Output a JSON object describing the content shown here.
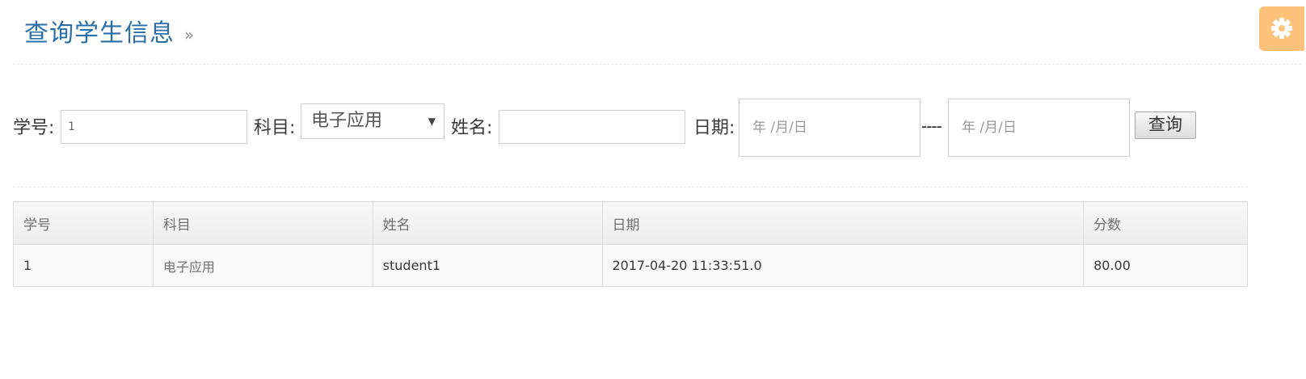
{
  "header": {
    "title": "查询学生信息",
    "chevron": "»"
  },
  "settings": {
    "icon": "gear-icon",
    "color": "#ffc27a"
  },
  "search": {
    "student_id_label": "学号:",
    "student_id_value": "1",
    "subject_label": "科目:",
    "subject_selected": "电子应用",
    "name_label": "姓名:",
    "name_value": "",
    "date_label": "日期:",
    "date_from_placeholder": "年 /月/日",
    "date_separator": "----",
    "date_to_placeholder": "年 /月/日",
    "query_button": "查询"
  },
  "table": {
    "columns": [
      "学号",
      "科目",
      "姓名",
      "日期",
      "分数"
    ],
    "rows": [
      [
        "1",
        "电子应用",
        "student1",
        "2017-04-20 11:33:51.0",
        "80.00"
      ]
    ]
  },
  "colors": {
    "title": "#2a6ea6",
    "border": "#dcdcdc",
    "header_bg": "#ececec"
  }
}
